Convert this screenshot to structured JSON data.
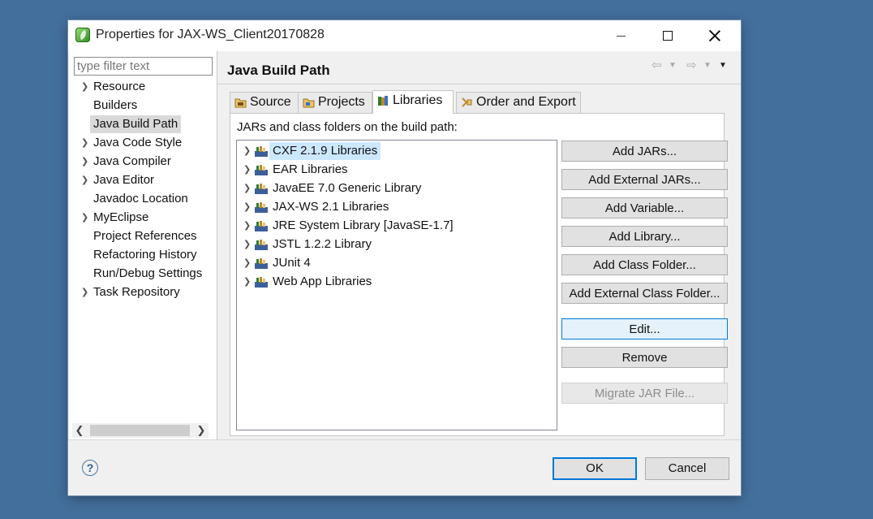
{
  "window": {
    "title": "Properties for JAX-WS_Client20170828"
  },
  "sidebar": {
    "filter_placeholder": "type filter text",
    "items": [
      {
        "label": "Resource",
        "expandable": true
      },
      {
        "label": "Builders",
        "expandable": false
      },
      {
        "label": "Java Build Path",
        "expandable": false,
        "selected": true
      },
      {
        "label": "Java Code Style",
        "expandable": true
      },
      {
        "label": "Java Compiler",
        "expandable": true
      },
      {
        "label": "Java Editor",
        "expandable": true
      },
      {
        "label": "Javadoc Location",
        "expandable": false
      },
      {
        "label": "MyEclipse",
        "expandable": true
      },
      {
        "label": "Project References",
        "expandable": false
      },
      {
        "label": "Refactoring History",
        "expandable": false
      },
      {
        "label": "Run/Debug Settings",
        "expandable": false
      },
      {
        "label": "Task Repository",
        "expandable": true
      }
    ]
  },
  "main": {
    "title": "Java Build Path",
    "tabs": [
      {
        "label": "Source",
        "icon": "source-folder-icon"
      },
      {
        "label": "Projects",
        "icon": "projects-icon"
      },
      {
        "label": "Libraries",
        "icon": "libraries-icon",
        "active": true
      },
      {
        "label": "Order and Export",
        "icon": "order-export-icon"
      }
    ],
    "panel_label": "JARs and class folders on the build path:",
    "libraries": [
      {
        "label": "CXF 2.1.9 Libraries",
        "selected": true
      },
      {
        "label": "EAR Libraries"
      },
      {
        "label": "JavaEE 7.0 Generic Library"
      },
      {
        "label": "JAX-WS 2.1 Libraries"
      },
      {
        "label": "JRE System Library [JavaSE-1.7]"
      },
      {
        "label": "JSTL 1.2.2 Library"
      },
      {
        "label": "JUnit 4"
      },
      {
        "label": "Web App Libraries"
      }
    ],
    "buttons": {
      "add_jars": "Add JARs...",
      "add_external_jars": "Add External JARs...",
      "add_variable": "Add Variable...",
      "add_library": "Add Library...",
      "add_class_folder": "Add Class Folder...",
      "add_external_class_folder": "Add External Class Folder...",
      "edit": "Edit...",
      "remove": "Remove",
      "migrate_jar": "Migrate JAR File..."
    }
  },
  "footer": {
    "help": "?",
    "ok": "OK",
    "cancel": "Cancel"
  },
  "colors": {
    "desktop": "#436f9c",
    "accent": "#0078d7",
    "selection": "#cce8ff"
  }
}
